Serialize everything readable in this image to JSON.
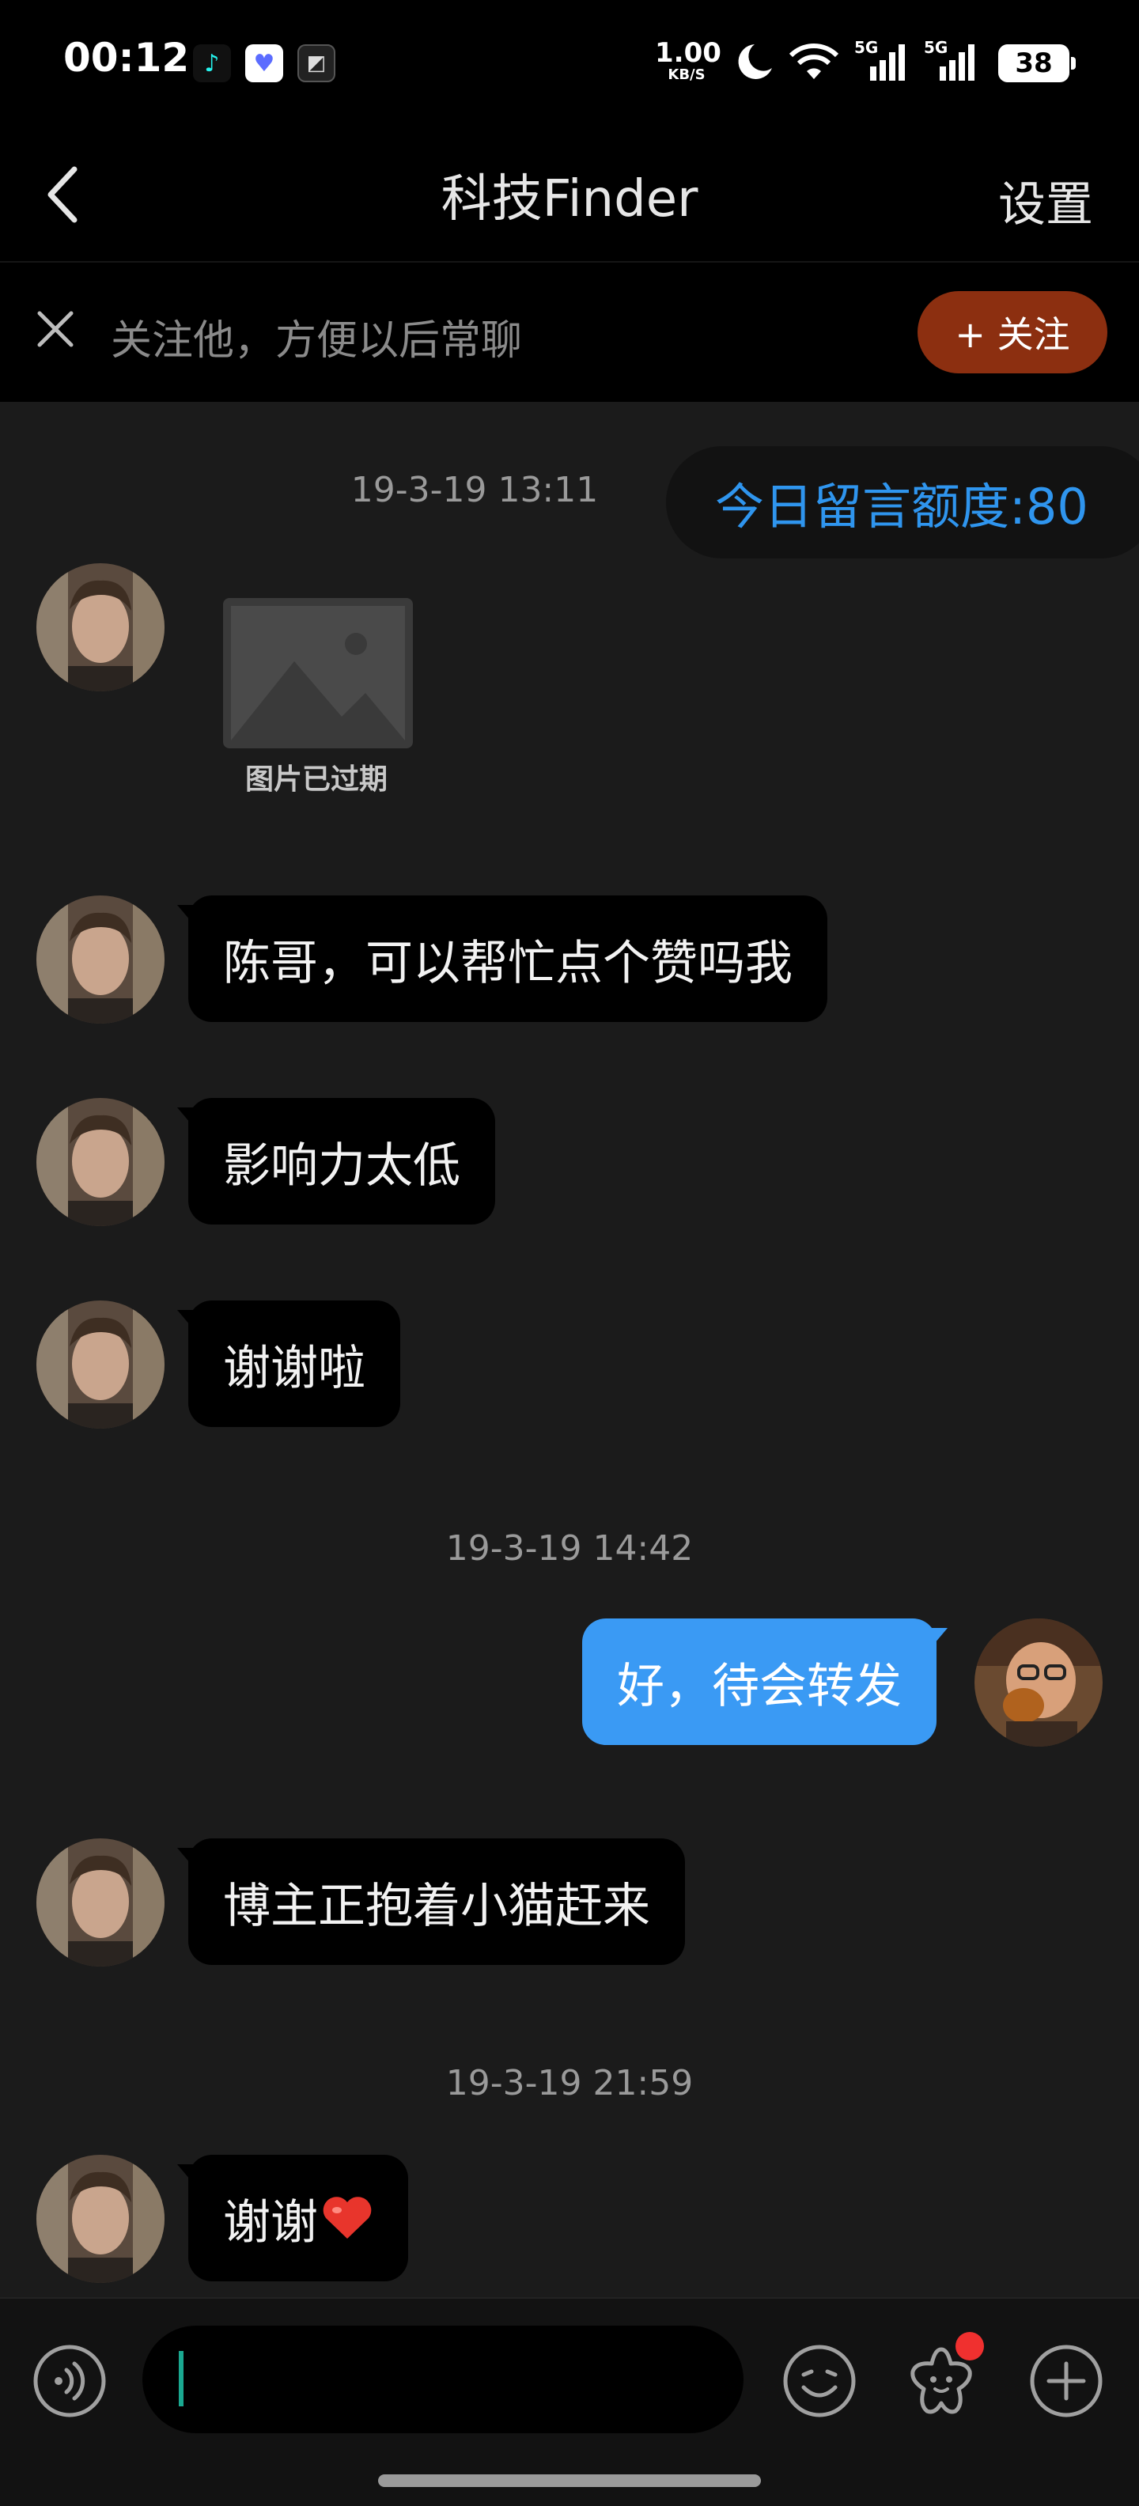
{
  "status_bar": {
    "time": "00:12",
    "net_speed_value": "1.00",
    "net_speed_unit": "KB/S",
    "signal_1": "5G",
    "signal_2": "5G",
    "battery": "38"
  },
  "nav": {
    "title": "科技Finder",
    "settings_label": "设置"
  },
  "follow_bar": {
    "prompt": "关注他，方便以后常聊",
    "follow_label": "+ 关注"
  },
  "chat": {
    "quota_tip": "今日留言额度:80",
    "timestamps": [
      "19-3-19 13:11",
      "19-3-19 14:42",
      "19-3-19 21:59"
    ],
    "expired_image_label": "图片已过期",
    "messages": [
      {
        "from": "other",
        "text": "陈哥，可以帮忙点个赞吗我"
      },
      {
        "from": "other",
        "text": "影响力太低"
      },
      {
        "from": "other",
        "text": "谢谢啦"
      },
      {
        "from": "me",
        "text": "好，待会转发"
      },
      {
        "from": "other",
        "text": "博主正抱着小猫赶来"
      },
      {
        "from": "other",
        "text": "谢谢"
      }
    ]
  },
  "input": {
    "placeholder": ""
  },
  "colors": {
    "background": "#1b1b1b",
    "bubble_in": "#000000",
    "bubble_out": "#3a9af4",
    "quota_text": "#2f95ee",
    "follow_button": "#8c2f10"
  },
  "icons": [
    "back-icon",
    "close-icon",
    "voice-icon",
    "emoji-icon",
    "sticker-icon",
    "add-icon",
    "heart-icon",
    "image-placeholder-icon"
  ]
}
